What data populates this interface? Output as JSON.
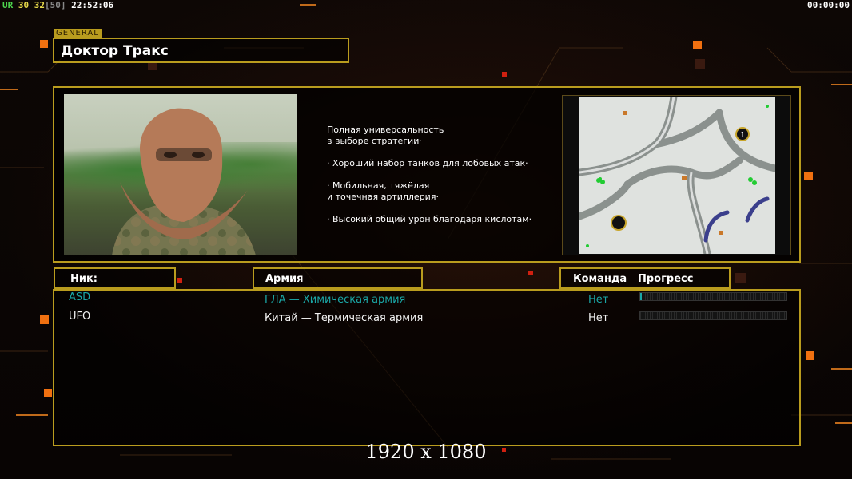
{
  "hud": {
    "ur_label": "UR",
    "num_1": "30",
    "num_2": "32",
    "num_3": "[50]",
    "clock": "22:52:06",
    "timer": "00:00:00"
  },
  "header": {
    "tag": "GENERAL",
    "title": "Доктор Тракс"
  },
  "description": {
    "lines": [
      "Полная универсальность",
      "в выборе стратегии·",
      "",
      "· Хороший набор танков для лобовых атак·",
      "",
      "· Мобильная, тяжёлая",
      "и точечная артиллерия·",
      "",
      "· Высокий общий урон благодаря кислотам·"
    ]
  },
  "map": {
    "marker_1": "1"
  },
  "columns": {
    "nick": "Ник:",
    "army": "Армия",
    "team": "Команда",
    "progress": "Прогресс"
  },
  "players": [
    {
      "nick": "ASD",
      "army": "ГЛА — Химическая армия",
      "team": "Нет",
      "progress": 0.01,
      "color": "#1aa6a6"
    },
    {
      "nick": "UFO",
      "army": "Китай — Термическая армия",
      "team": "Нет",
      "progress": 0.0,
      "color": "#f2f2f2"
    }
  ],
  "resolution_label": "1920 x 1080",
  "colors": {
    "accent_gold": "#b99c1e",
    "teal": "#1aa6a6",
    "hud_green": "#4dd34d",
    "hud_yellow": "#e6d84a"
  }
}
